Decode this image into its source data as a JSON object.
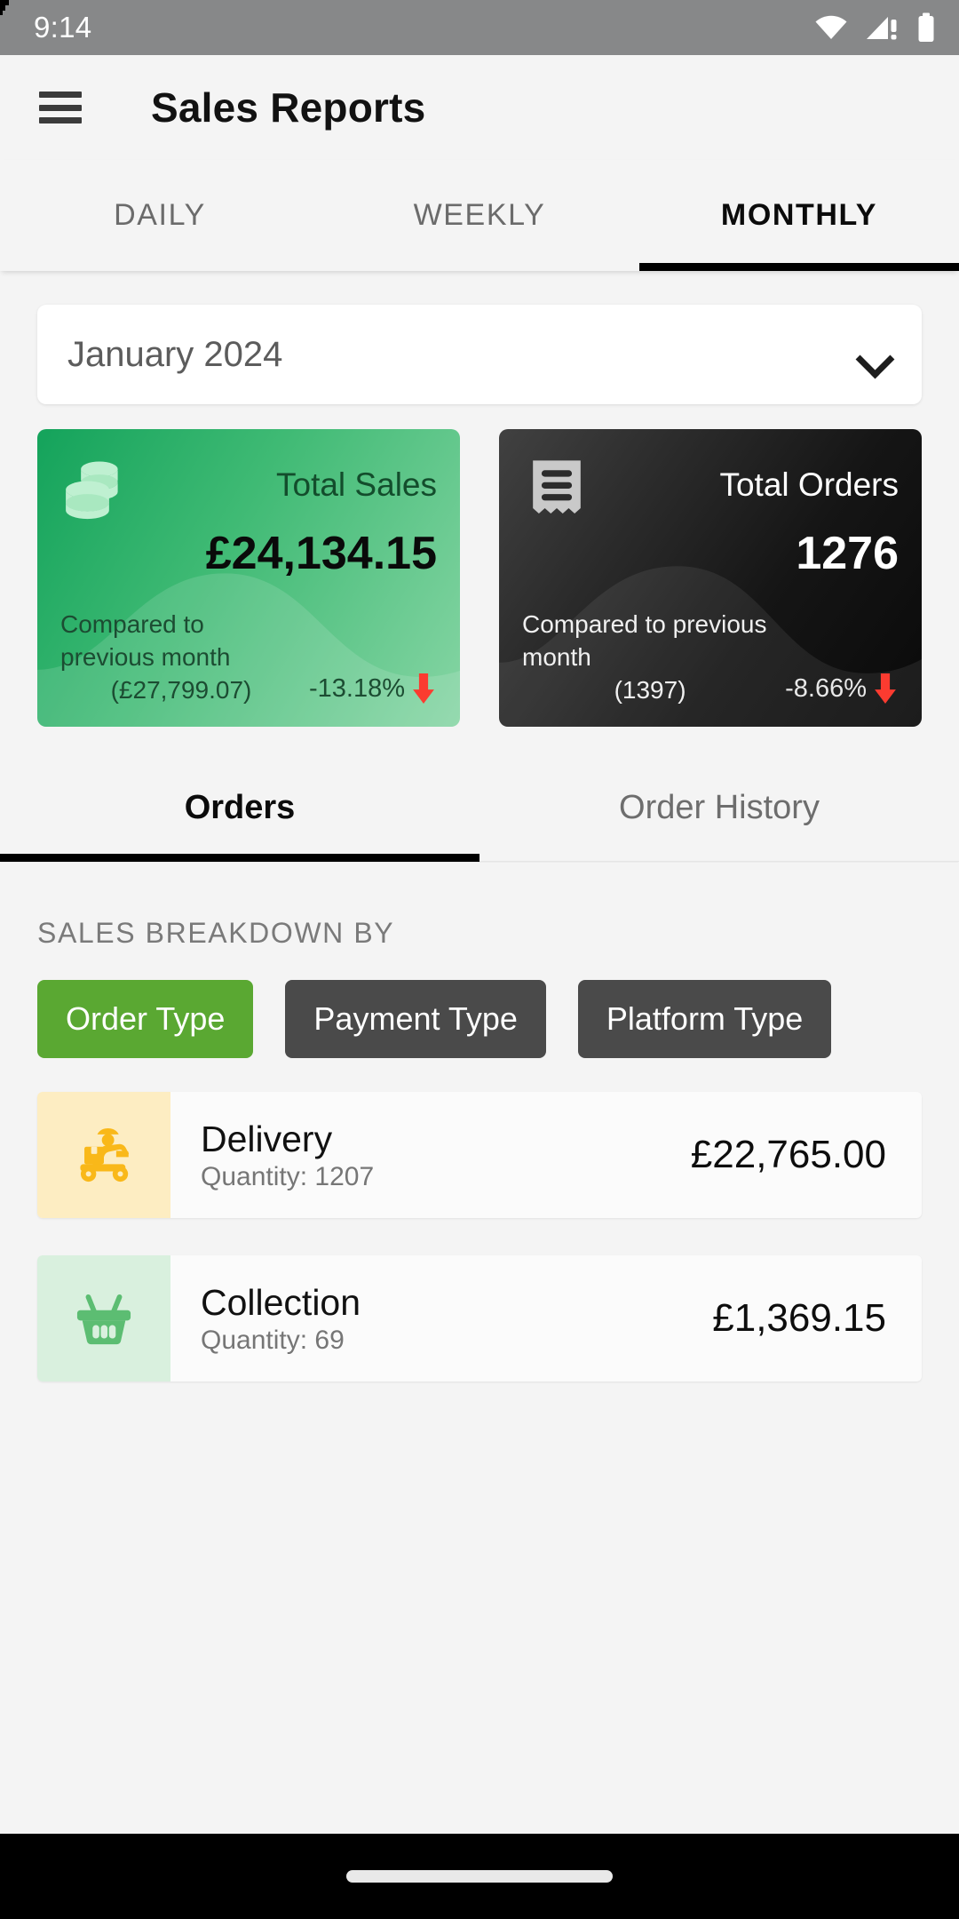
{
  "status_bar": {
    "time": "9:14",
    "icons": [
      "wifi-icon",
      "cellular-signal-warning-icon",
      "battery-icon"
    ]
  },
  "app_bar": {
    "menu_icon": "hamburger-menu-icon",
    "title": "Sales Reports"
  },
  "period_tabs": [
    {
      "label": "DAILY",
      "active": false
    },
    {
      "label": "WEEKLY",
      "active": false
    },
    {
      "label": "MONTHLY",
      "active": true
    }
  ],
  "month_selector": {
    "value": "January 2024",
    "icon": "chevron-down-icon"
  },
  "metrics": [
    {
      "id": "total-sales",
      "title": "Total Sales",
      "value": "£24,134.15",
      "compare_label": "Compared to previous month",
      "compare_value": "(£27,799.07)",
      "delta": "-13.18%",
      "delta_direction": "down",
      "icon": "coins-stack-icon",
      "theme": "green",
      "accent": "#14a35b"
    },
    {
      "id": "total-orders",
      "title": "Total Orders",
      "value": "1276",
      "compare_label": "Compared to previous month",
      "compare_value": "(1397)",
      "delta": "-8.66%",
      "delta_direction": "down",
      "icon": "receipt-icon",
      "theme": "dark",
      "accent": "#151515"
    }
  ],
  "sub_tabs": [
    {
      "label": "Orders",
      "active": true
    },
    {
      "label": "Order History",
      "active": false
    }
  ],
  "breakdown": {
    "section_title": "SALES BREAKDOWN BY",
    "chips": [
      {
        "label": "Order Type",
        "active": true
      },
      {
        "label": "Payment Type",
        "active": false
      },
      {
        "label": "Platform Type",
        "active": false
      }
    ],
    "rows": [
      {
        "label": "Delivery",
        "quantity_label": "Quantity: 1207",
        "amount": "£22,765.00",
        "icon": "delivery-scooter-icon",
        "icon_color": "#f9b819",
        "icon_bg": "#fdedc2"
      },
      {
        "label": "Collection",
        "quantity_label": "Quantity: 69",
        "amount": "£1,369.15",
        "icon": "shopping-basket-icon",
        "icon_color": "#5cbd72",
        "icon_bg": "#d9f0de"
      }
    ]
  },
  "colors": {
    "page_background": "#f4f4f4",
    "status_bar": "#878889",
    "accent_green": "#5aa832",
    "chip_inactive": "#4a4a4a",
    "negative_arrow": "#ff3b30",
    "nav_bar": "#000000"
  },
  "nav_bar": {
    "handle": "gesture-home-indicator"
  }
}
